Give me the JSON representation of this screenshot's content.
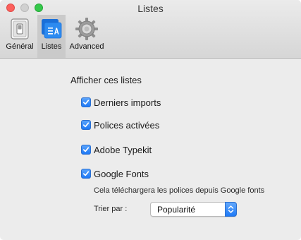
{
  "window": {
    "title": "Listes"
  },
  "toolbar": {
    "items": [
      {
        "label": "Général",
        "icon": "switch-icon"
      },
      {
        "label": "Listes",
        "icon": "list-icon",
        "selected": true
      },
      {
        "label": "Advanced",
        "icon": "gear-icon"
      }
    ]
  },
  "content": {
    "section_title": "Afficher ces listes",
    "options": [
      {
        "label": "Derniers imports",
        "checked": true
      },
      {
        "label": "Polices activées",
        "checked": true
      },
      {
        "label": "Adobe Typekit",
        "checked": true
      },
      {
        "label": "Google Fonts",
        "checked": true
      }
    ],
    "google_note": "Cela téléchargera les polices depuis Google fonts",
    "sort": {
      "label": "Trier par :",
      "value": "Popularité"
    }
  },
  "colors": {
    "accent": "#1e78f5",
    "close": "#fc605c",
    "zoom": "#34c84a"
  }
}
